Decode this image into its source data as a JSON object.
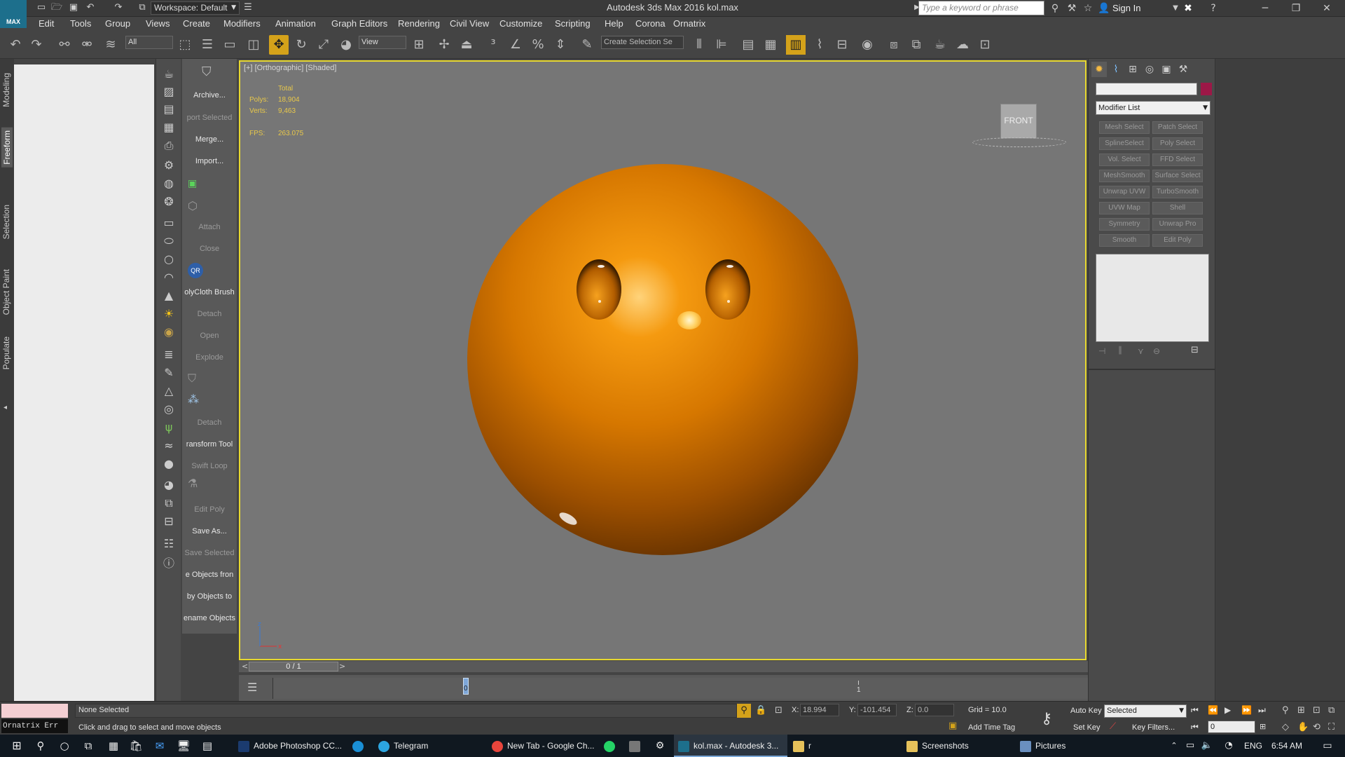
{
  "titlebar": {
    "logo_text": "MAX",
    "workspace": "Workspace: Default",
    "app_title": "Autodesk 3ds Max 2016      kol.max",
    "search_placeholder": "Type a keyword or phrase",
    "sign_in": "Sign In"
  },
  "menu": [
    "Edit",
    "Tools",
    "Group",
    "Views",
    "Create",
    "Modifiers",
    "Animation",
    "Graph Editors",
    "Rendering",
    "Civil View",
    "Customize",
    "Scripting",
    "Help",
    "Corona",
    "Ornatrix"
  ],
  "toolbar": {
    "selection_filter": "All",
    "ref_coord": "View",
    "named_selection": "Create Selection Se"
  },
  "left_tabs": [
    "Modeling",
    "Freeform",
    "Selection",
    "Object Paint",
    "Populate"
  ],
  "label_column": [
    {
      "text": "Archive...",
      "enabled": true
    },
    {
      "text": "port Selected",
      "enabled": false
    },
    {
      "text": "Merge...",
      "enabled": true
    },
    {
      "text": "Import...",
      "enabled": true
    },
    {
      "text": "Attach",
      "enabled": false
    },
    {
      "text": "Close",
      "enabled": false
    },
    {
      "text": "olyCloth Brush",
      "enabled": true
    },
    {
      "text": "Detach",
      "enabled": false
    },
    {
      "text": "Open",
      "enabled": false
    },
    {
      "text": "Explode",
      "enabled": false
    },
    {
      "text": "Detach",
      "enabled": false
    },
    {
      "text": "ransform Tool",
      "enabled": true
    },
    {
      "text": "Swift Loop",
      "enabled": false
    },
    {
      "text": "Edit Poly",
      "enabled": false
    },
    {
      "text": "Save As...",
      "enabled": true
    },
    {
      "text": "Save Selected",
      "enabled": false
    },
    {
      "text": "e Objects fron",
      "enabled": true
    },
    {
      "text": "by Objects to",
      "enabled": true
    },
    {
      "text": "ename Objects",
      "enabled": true
    }
  ],
  "viewport": {
    "label": "[+] [Orthographic] [Shaded]",
    "stats_header": "Total",
    "polys_label": "Polys:",
    "polys_value": "18,904",
    "verts_label": "Verts:",
    "verts_value": "9,463",
    "fps_label": "FPS:",
    "fps_value": "263.075",
    "viewcube_label": "FRONT",
    "axis_x": "x",
    "axis_z": "z",
    "sphere_color": "#d67700"
  },
  "timeline": {
    "frame": "0 / 1",
    "marker_0": "0",
    "marker_1": "1"
  },
  "command_panel": {
    "modifier_list": "Modifier List",
    "buttons": [
      "Mesh Select",
      "Patch Select",
      "SplineSelect",
      "Poly Select",
      "Vol. Select",
      "FFD Select",
      "MeshSmooth",
      "Surface Select",
      "Unwrap UVW",
      "TurboSmooth",
      "UVW Map",
      "Shell",
      "Symmetry",
      "Unwrap Pro",
      "Smooth",
      "Edit Poly"
    ],
    "object_color": "#9c1847"
  },
  "status": {
    "maxscript_text": "Ornatrix Err",
    "selection": "None Selected",
    "prompt": "Click and drag to select and move objects",
    "x_label": "X:",
    "x_value": "18.994",
    "y_label": "Y:",
    "y_value": "-101.454",
    "z_label": "Z:",
    "z_value": "0.0",
    "grid": "Grid = 10.0",
    "add_time_tag": "Add Time Tag",
    "auto_key": "Auto Key",
    "set_key": "Set Key",
    "selected": "Selected",
    "key_filters": "Key Filters...",
    "frame_field": "0"
  },
  "taskbar": {
    "items": [
      "Adobe Photoshop CC...",
      "Telegram",
      "New Tab - Google Ch...",
      "kol.max - Autodesk 3...",
      "r",
      "Screenshots",
      "Pictures"
    ],
    "lang": "ENG",
    "time": "6:54 AM"
  }
}
